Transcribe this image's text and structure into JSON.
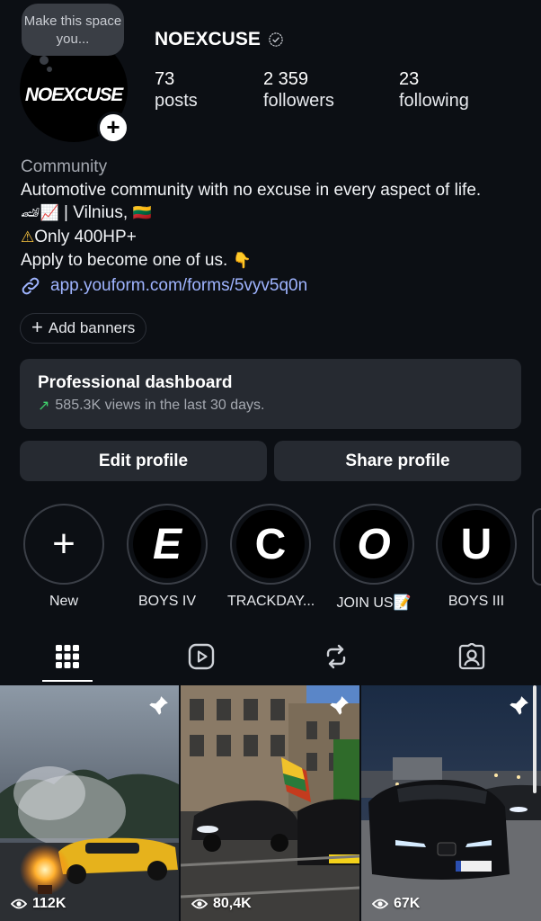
{
  "profile": {
    "note": "Make this space you...",
    "avatar_logo": "NOEXCUSE",
    "username": "NOEXCUSE",
    "stats": [
      {
        "value": "73",
        "label": "posts"
      },
      {
        "value": "2 359",
        "label": "followers"
      },
      {
        "value": "23",
        "label": "following"
      }
    ]
  },
  "bio": {
    "category": "Community",
    "line1": "Automotive community with no excuse in every aspect of life.",
    "line2_emoji": "🏎📈",
    "line2_text": " | Vilnius, ",
    "line2_flag": "🇱🇹",
    "line3_emoji": "⚠",
    "line3_text": "Only 400HP+",
    "line4_text": "Apply to become one of us. ",
    "line4_emoji": "👇",
    "link": "app.youform.com/forms/5vyv5q0n"
  },
  "buttons": {
    "add_banners": "Add banners",
    "edit_profile": "Edit profile",
    "share_profile": "Share profile"
  },
  "dashboard": {
    "title": "Professional dashboard",
    "subtitle": "585.3K views in the last 30 days."
  },
  "highlights": [
    {
      "letter": "+",
      "label": "New"
    },
    {
      "letter": "E",
      "label": "BOYS IV"
    },
    {
      "letter": "C",
      "label": "TRACKDAY..."
    },
    {
      "letter": "O",
      "label": "JOIN US📝"
    },
    {
      "letter": "U",
      "label": "BOYS III"
    }
  ],
  "tabs": [
    "grid-icon",
    "reels-icon",
    "reposts-icon",
    "tagged-icon"
  ],
  "posts": [
    {
      "views": "112K"
    },
    {
      "views": "80,4K"
    },
    {
      "views": "67K"
    }
  ],
  "colors": {
    "background": "#0c0f14",
    "card": "#262a31",
    "link": "#9fb4ff",
    "trend_green": "#3ecf6b"
  }
}
